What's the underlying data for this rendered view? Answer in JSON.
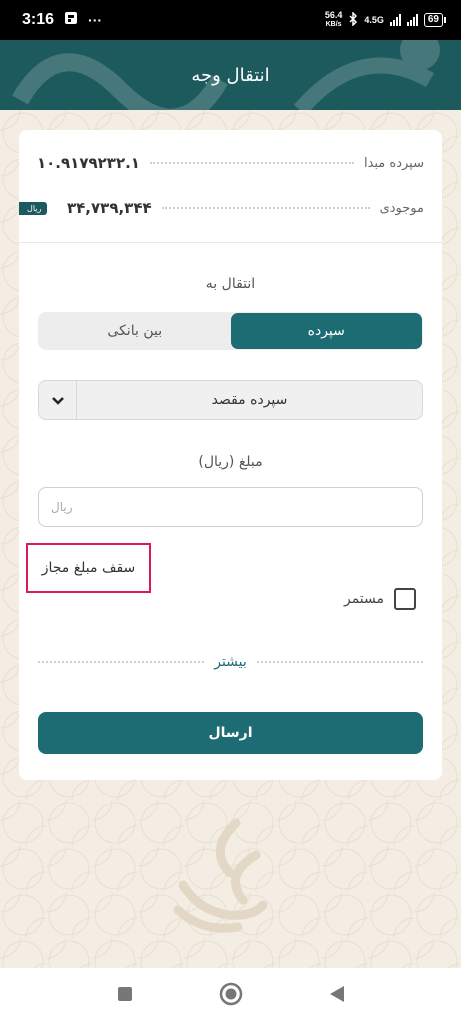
{
  "status_bar": {
    "time": "3:16",
    "dots": "···",
    "speed_value": "56.4",
    "speed_unit": "KB/s",
    "network": "4.5G",
    "battery": "69"
  },
  "header": {
    "title": "انتقال وجه"
  },
  "account": {
    "source_label": "سپرده مبدا",
    "source_value": "۱۰.۹۱۷۹۲۳۲.۱",
    "balance_label": "موجودی",
    "balance_value": "۳۴,۷۳۹,۳۴۴",
    "currency_tag": "ریال"
  },
  "transfer": {
    "transfer_to_label": "انتقال به",
    "tabs": [
      {
        "label": "سپرده",
        "active": true
      },
      {
        "label": "بین بانکی",
        "active": false
      }
    ],
    "destination_select": "سپرده مقصد",
    "amount_label": "مبلغ (ریال)",
    "amount_placeholder": "ریال",
    "amount_value": "",
    "limit_label": "سقف مبلغ مجاز",
    "recurring_label": "مستمر",
    "recurring_checked": false,
    "more_label": "بیشتر",
    "submit_label": "ارسال"
  },
  "theme": {
    "primary": "#1d6b73",
    "header_bg": "#1d5a5e",
    "page_bg": "#f3ede3",
    "highlight": "#d81b60"
  },
  "icons": {
    "select_arrow": "chevron-down-icon",
    "nav_recents": "square-icon",
    "nav_home": "circle-icon",
    "nav_back": "triangle-back-icon"
  }
}
